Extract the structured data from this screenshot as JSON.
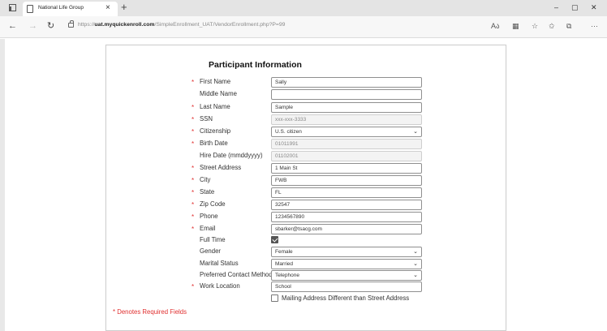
{
  "browser": {
    "tab_title": "National Life Group",
    "tab_close": "×",
    "new_tab": "+",
    "win_minimize": "–",
    "win_maximize": "▢",
    "win_close": "✕",
    "url_prefix": "https://",
    "url_host": "uat.myquickenroll.com",
    "url_path": "/SimpleEnrollment_UAT/VendorEnrollment.php?P=99",
    "icons": [
      "back-icon",
      "forward-icon",
      "refresh-icon",
      "lock-icon",
      "read-aloud-icon",
      "extensions-icon",
      "favorites-add-icon",
      "favorites-icon",
      "collections-icon",
      "more-icon"
    ]
  },
  "form": {
    "title": "Participant Information",
    "fields": {
      "first_name": {
        "label": "First Name",
        "value": "Sally",
        "required": true
      },
      "middle_name": {
        "label": "Middle Name",
        "value": "",
        "required": false
      },
      "last_name": {
        "label": "Last Name",
        "value": "Sample",
        "required": true
      },
      "ssn": {
        "label": "SSN",
        "value": "xxx-xxx-3333",
        "required": true
      },
      "citizenship": {
        "label": "Citizenship",
        "value": "U.S. citizen",
        "required": true
      },
      "birth_date": {
        "label": "Birth Date",
        "value": "01011991",
        "required": true
      },
      "hire_date": {
        "label": "Hire Date (mmddyyyy)",
        "value": "01102001",
        "required": false
      },
      "street_address": {
        "label": "Street Address",
        "value": "1 Main St",
        "required": true
      },
      "city": {
        "label": "City",
        "value": "FWB",
        "required": true
      },
      "state": {
        "label": "State",
        "value": "FL",
        "required": true
      },
      "zip_code": {
        "label": "Zip Code",
        "value": "32547",
        "required": true
      },
      "phone": {
        "label": "Phone",
        "value": "1234567890",
        "required": true
      },
      "email": {
        "label": "Email",
        "value": "sbarker@tsacg.com",
        "required": true
      },
      "full_time": {
        "label": "Full Time",
        "checked": true,
        "required": false
      },
      "gender": {
        "label": "Gender",
        "value": "Female",
        "required": false
      },
      "marital_status": {
        "label": "Marital Status",
        "value": "Married",
        "required": false
      },
      "preferred_contact": {
        "label": "Preferred Contact Method",
        "value": "Telephone",
        "required": false
      },
      "work_location": {
        "label": "Work Location",
        "value": "School",
        "required": true
      },
      "mailing_different": {
        "label": "Mailing Address Different than Street Address",
        "checked": false
      }
    },
    "required_marker": "*",
    "required_note": "* Denotes Required Fields"
  },
  "colors": {
    "required": "#e03030",
    "accent_link": "#2a5db0"
  }
}
